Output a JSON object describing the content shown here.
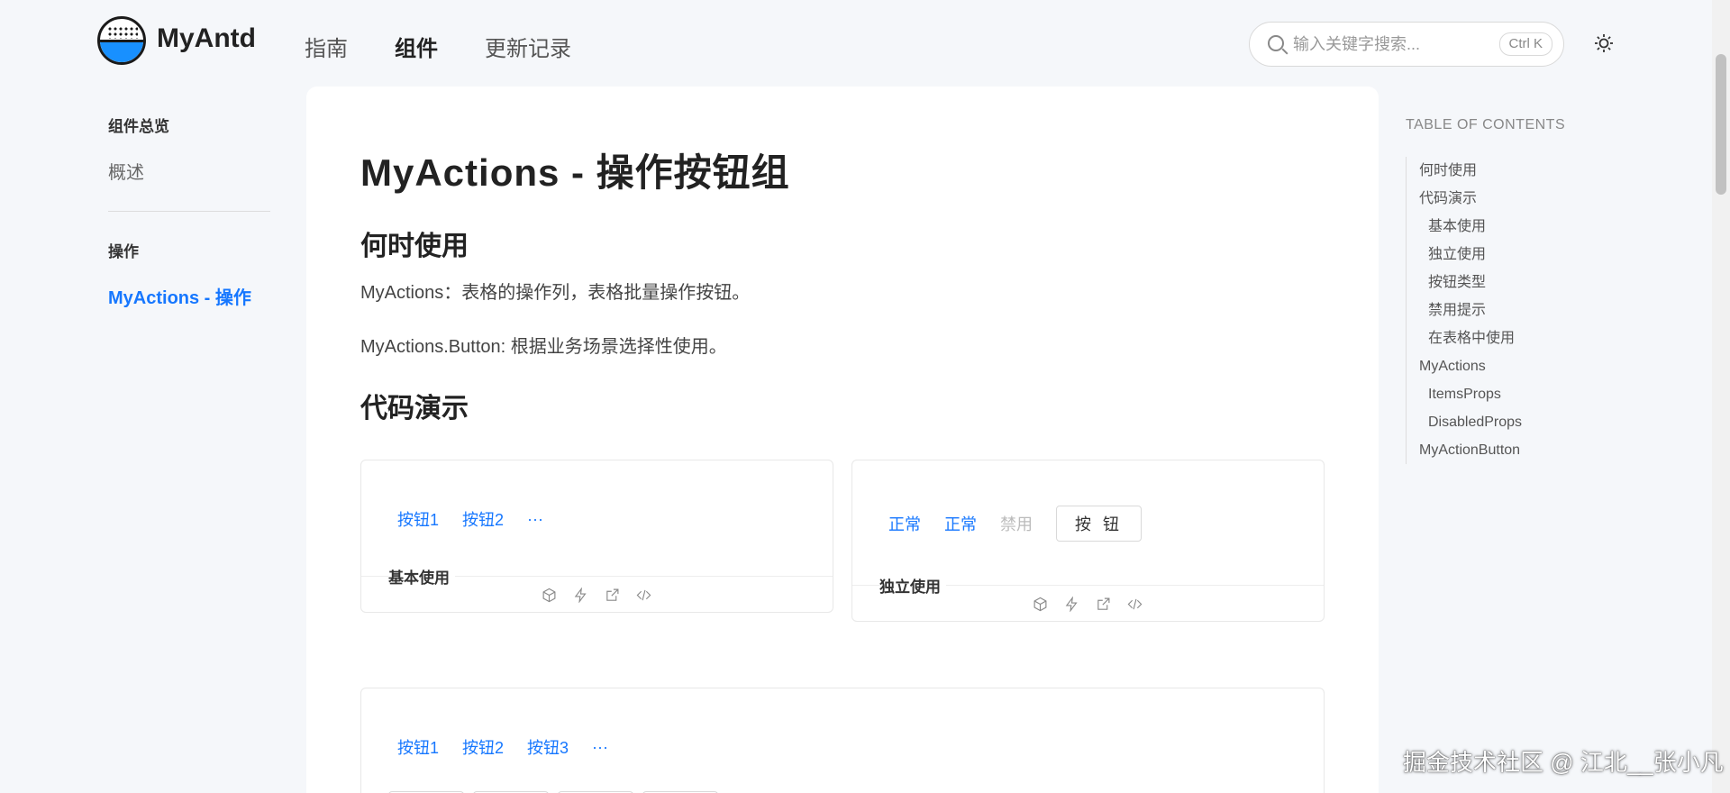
{
  "header": {
    "brand": "MyAntd",
    "nav": [
      "指南",
      "组件",
      "更新记录"
    ],
    "search_placeholder": "输入关键字搜索...",
    "search_shortcut": "Ctrl K"
  },
  "sidebar": {
    "groups": [
      {
        "title": "组件总览",
        "items": [
          "概述"
        ]
      },
      {
        "title": "操作",
        "items": [
          "MyActions - 操作"
        ]
      }
    ]
  },
  "main": {
    "title": "MyActions - 操作按钮组",
    "sections": {
      "when": "何时使用",
      "demo": "代码演示"
    },
    "paragraphs": [
      "MyActions：表格的操作列，表格批量操作按钮。",
      "MyActions.Button: 根据业务场景选择性使用。"
    ],
    "demo_basic": {
      "buttons": [
        "按钮1",
        "按钮2"
      ],
      "more": "···",
      "label": "基本使用"
    },
    "demo_independent": {
      "buttons": [
        "正常",
        "正常",
        "禁用"
      ],
      "outline_button": "按 钮",
      "label": "独立使用"
    },
    "demo_types": {
      "buttons": [
        "按钮1",
        "按钮2",
        "按钮3"
      ],
      "more": "···"
    }
  },
  "toc": {
    "title": "TABLE OF CONTENTS",
    "items": [
      {
        "label": "何时使用",
        "sub": false
      },
      {
        "label": "代码演示",
        "sub": false
      },
      {
        "label": "基本使用",
        "sub": true
      },
      {
        "label": "独立使用",
        "sub": true
      },
      {
        "label": "按钮类型",
        "sub": true
      },
      {
        "label": "禁用提示",
        "sub": true
      },
      {
        "label": "在表格中使用",
        "sub": true
      },
      {
        "label": "MyActions",
        "sub": false
      },
      {
        "label": "ItemsProps",
        "sub": true
      },
      {
        "label": "DisabledProps",
        "sub": true
      },
      {
        "label": "MyActionButton",
        "sub": false
      }
    ]
  },
  "watermark": "掘金技术社区 @ 江北__张小凡",
  "colors": {
    "accent": "#1677ff",
    "disabled": "#bbbbbb"
  },
  "icons": [
    "search-icon",
    "sun-icon",
    "codesandbox-icon",
    "codepen-icon",
    "external-link-icon",
    "code-icon"
  ]
}
